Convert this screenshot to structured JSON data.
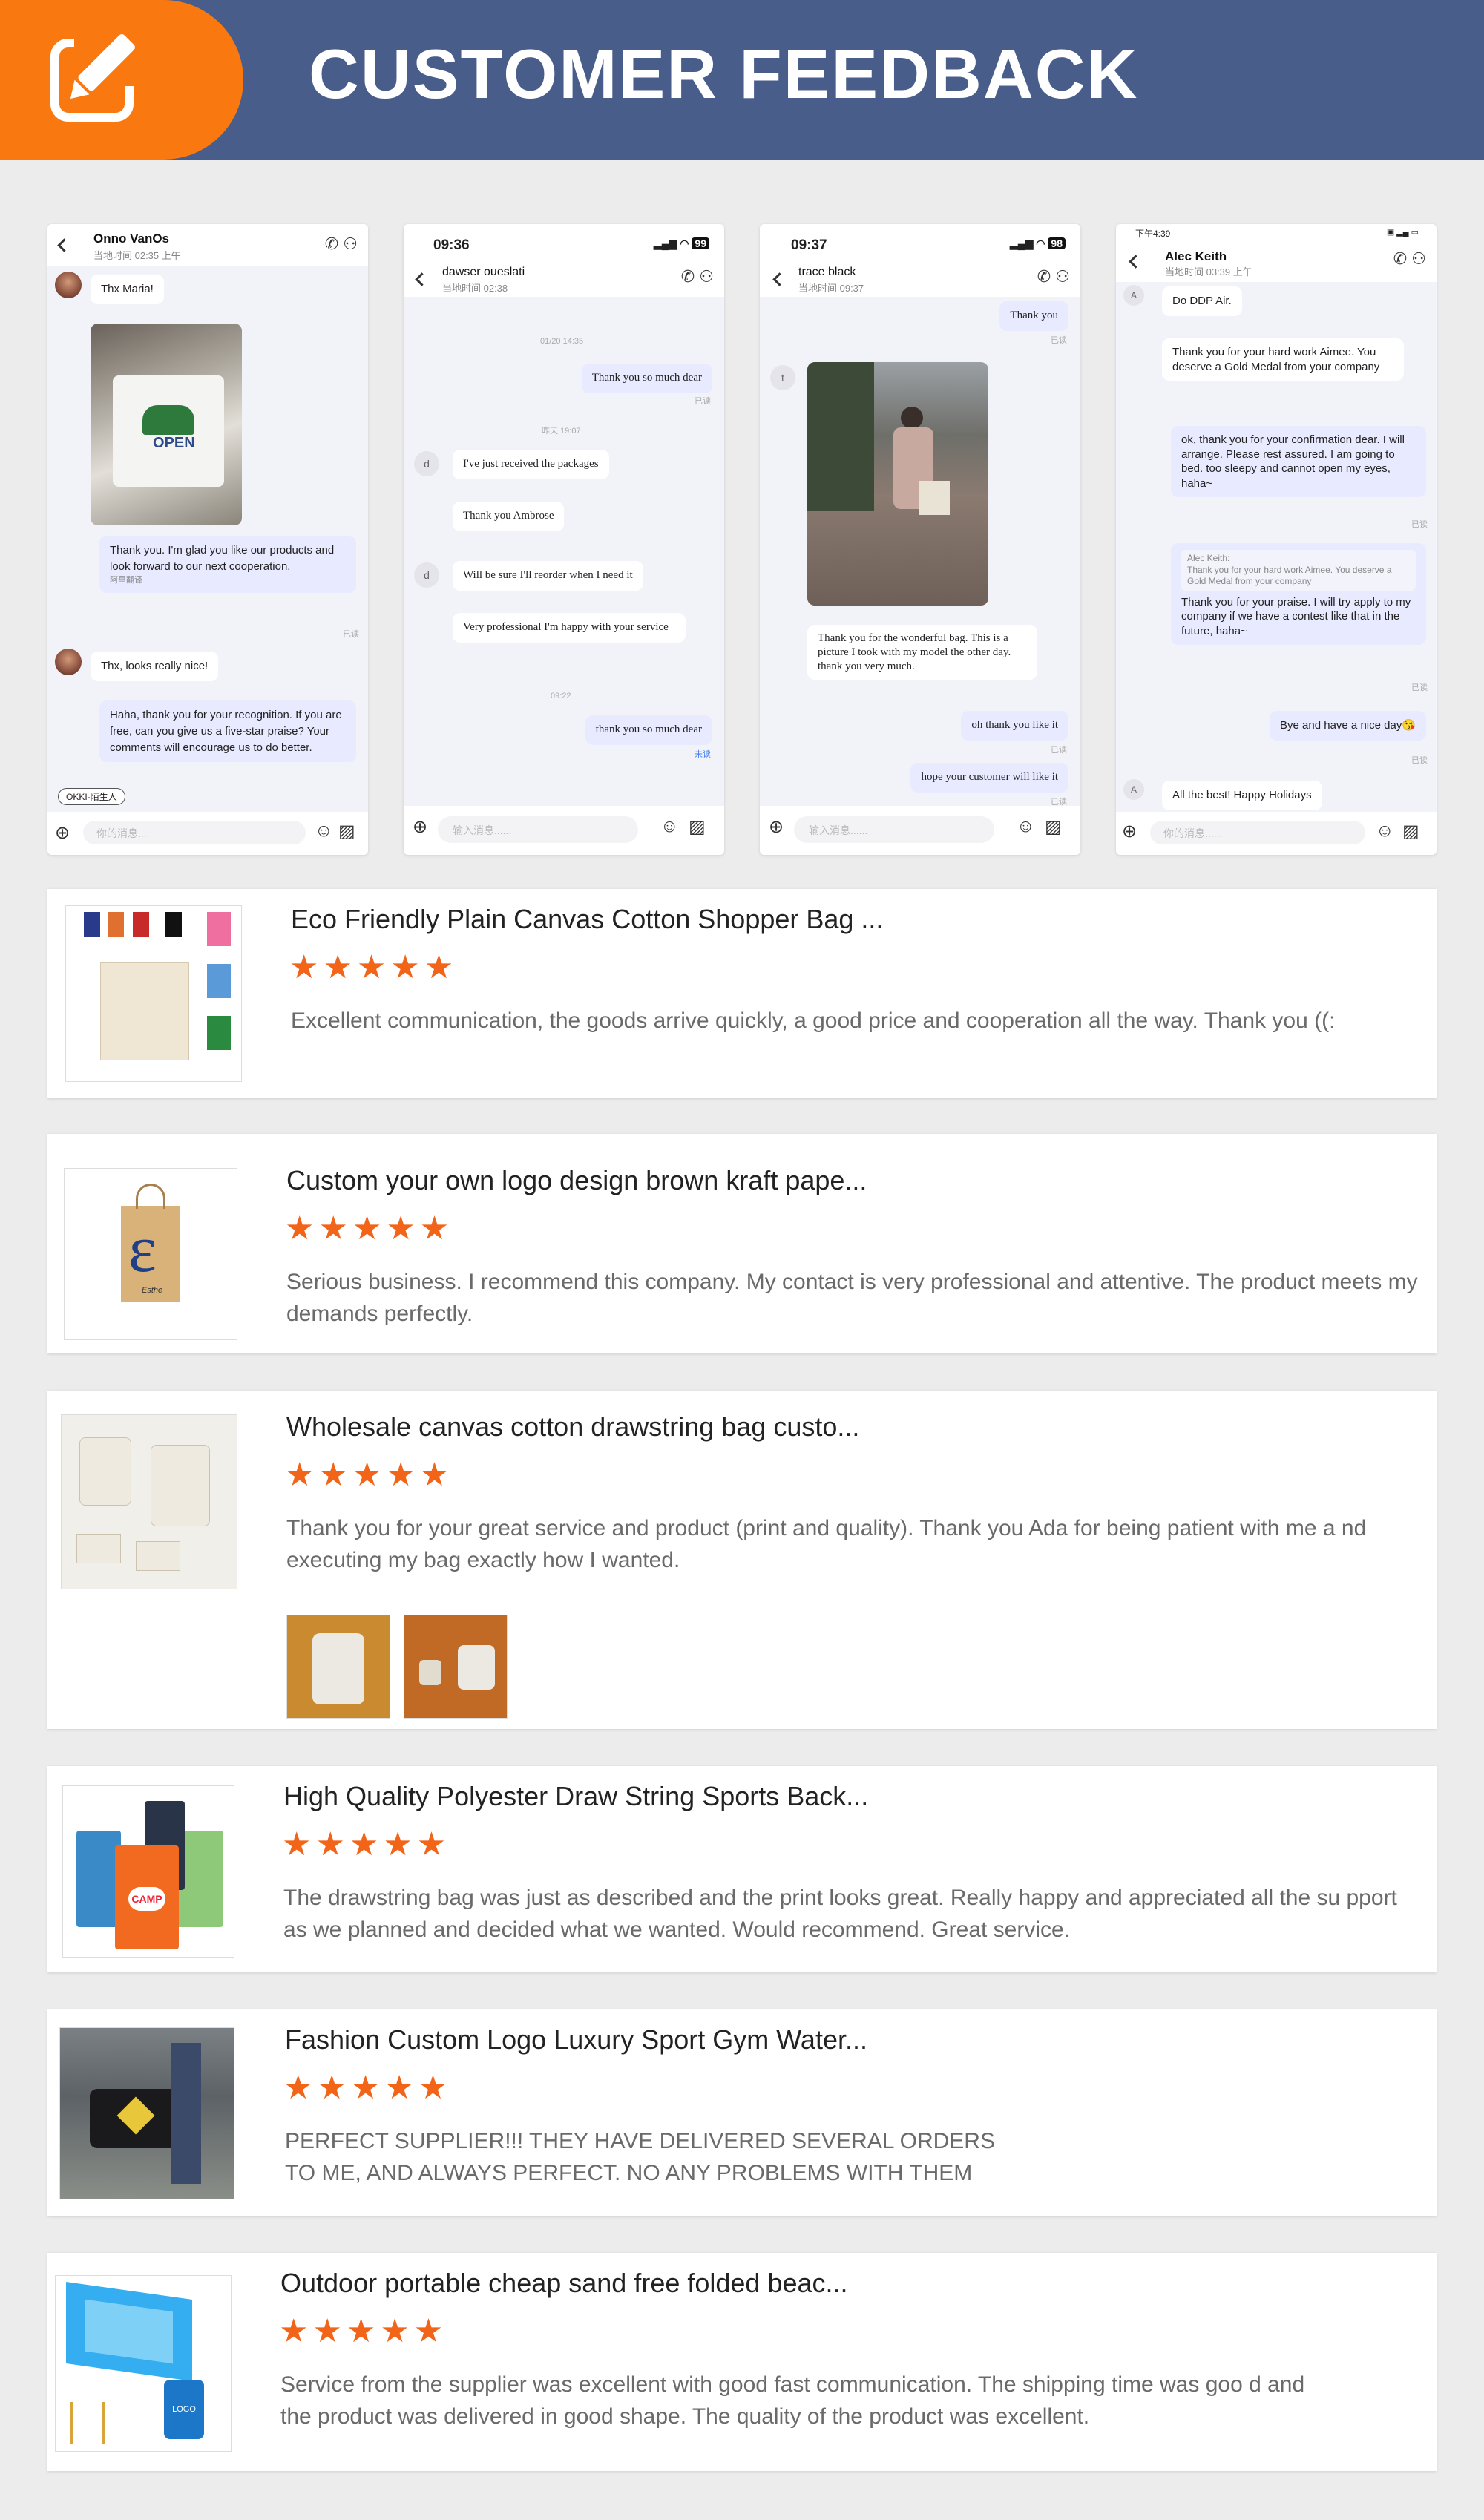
{
  "header": {
    "title": "CUSTOMER FEEDBACK",
    "icon": "edit-icon",
    "colors": {
      "band": "#485d8a",
      "badge": "#f9780f"
    }
  },
  "phones": [
    {
      "name": "Onno VanOs",
      "sub": "当地时间 02:35 上午",
      "messages": {
        "m1": "Thx Maria!",
        "m2": "Thank you. I'm glad you like our products and look forward to our next cooperation.",
        "m2_note": "阿里翻译",
        "read1": "已读",
        "m3": "Thx, looks really nice!",
        "m4": "Haha, thank you for your recognition. If you are free, can you give us a five-star praise? Your comments will encourage us to do better."
      },
      "tag": "OKKI-陌生人",
      "input_placeholder": "你的消息..."
    },
    {
      "status_time": "09:36",
      "battery": "99",
      "name": "dawser oueslati",
      "sub": "当地时间 02:38",
      "messages": {
        "t1": "01/20 14:35",
        "m1": "Thank you so much dear",
        "r1": "已读",
        "t2": "昨天 19:07",
        "m2": "I've just received the packages",
        "m3": "Thank you Ambrose",
        "m4": "Will be sure I'll reorder when I need it",
        "m5": "Very professional I'm happy with your service",
        "t3": "09:22",
        "m6": "thank you so much dear",
        "r2": "未读",
        "av": "d"
      },
      "input_placeholder": "输入消息......"
    },
    {
      "status_time": "09:37",
      "battery": "98",
      "name": "trace black",
      "sub": "当地时间 09:37",
      "messages": {
        "m1": "Thank you",
        "r1": "已读",
        "av": "t",
        "m2": "Thank you for the wonderful bag. This is a picture I took with my model the other day. thank you very much.",
        "m3": "oh thank you like it",
        "r2": "已读",
        "m4": "hope your customer will like it",
        "r3": "已读"
      },
      "input_placeholder": "输入消息......"
    },
    {
      "status_time": "下午4:39",
      "name": "Alec Keith",
      "sub": "当地时间 03:39 上午",
      "messages": {
        "av": "A",
        "m1": "Do DDP Air.",
        "m2": "Thank you for your hard work Aimee. You deserve a Gold Medal from your company",
        "m3": "ok, thank you for your confirmation dear. I will arrange. Please rest assured. I am going to bed. too sleepy and cannot open my eyes, haha~",
        "r1": "已读",
        "q_name": "Alec Keith:",
        "q_text": "Thank you for your hard work Aimee. You deserve a Gold Medal from your company",
        "m4": "Thank you for your praise. I will try apply to my company if we have a contest like that in the future, haha~",
        "r2": "已读",
        "m5": "Bye and have a nice day😘",
        "r3": "已读",
        "m6": "All the best! Happy Holidays"
      },
      "input_placeholder": "你的消息......"
    }
  ],
  "reviews": [
    {
      "title": "Eco Friendly Plain Canvas Cotton Shopper Bag ...",
      "stars": "★★★★★",
      "rating": 5,
      "text": "Excellent communication, the goods arrive quickly, a good price and cooperation all the way. Thank you ((:"
    },
    {
      "title": "Custom your own logo design brown kraft pape...",
      "stars": "★★★★★",
      "rating": 5,
      "text": "Serious business. I recommend this company. My contact is very professional and attentive. The product meets my demands perfectly.",
      "logo": "Esthe"
    },
    {
      "title": "Wholesale canvas cotton drawstring bag custo...",
      "stars": "★★★★★",
      "rating": 5,
      "text": "Thank you for your great service and product (print and quality). Thank you Ada for being patient with me a nd executing my bag exactly how I wanted."
    },
    {
      "title": "High Quality Polyester Draw String Sports Back...",
      "stars": "★★★★★",
      "rating": 5,
      "text": "The drawstring bag was just as described and the print looks great. Really happy and appreciated all the su pport as we planned and decided what we wanted. Would recommend. Great service."
    },
    {
      "title": "Fashion Custom Logo Luxury Sport Gym Water...",
      "stars": "★★★★★",
      "rating": 5,
      "text": "PERFECT SUPPLIER!!! THEY HAVE DELIVERED SEVERAL ORDERS TO ME, AND ALWAYS PERFECT. NO ANY PROBLEMS WITH THEM"
    },
    {
      "title": "Outdoor portable cheap sand free folded beac...",
      "stars": "★★★★★",
      "rating": 5,
      "text": "Service from the supplier was excellent with good fast communication. The shipping time was goo d and the product was delivered in good shape. The quality of the product was excellent.",
      "logo": "LOGO"
    }
  ]
}
